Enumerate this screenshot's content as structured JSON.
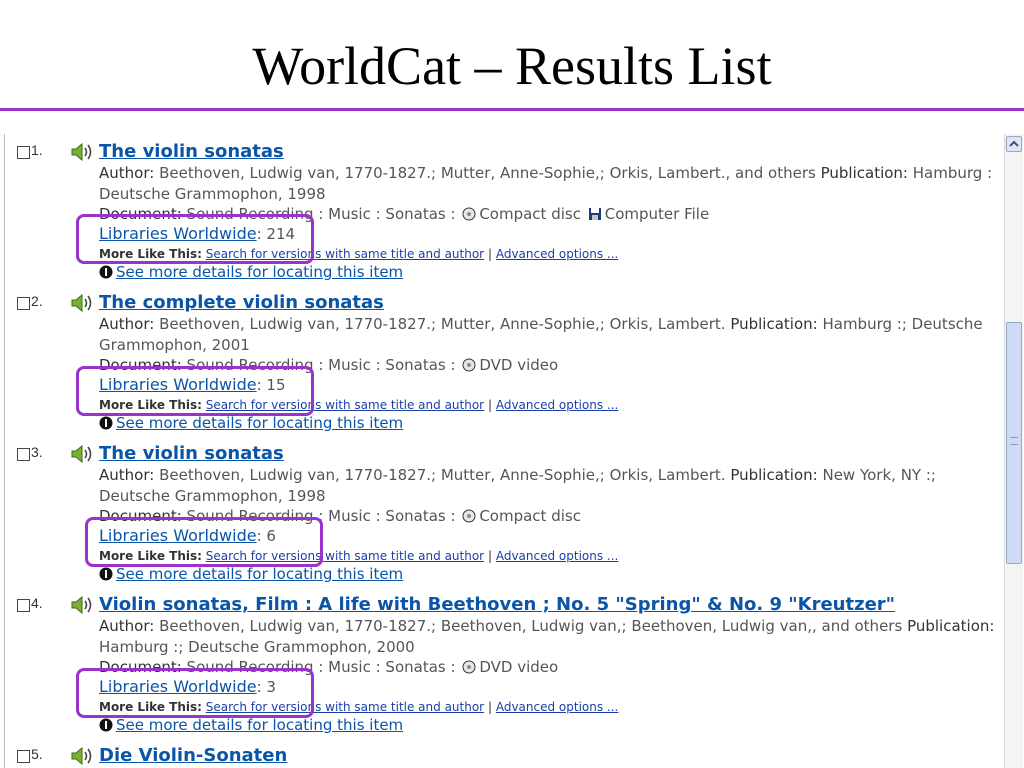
{
  "slide": {
    "title": "WorldCat – Results List"
  },
  "labels": {
    "author": "Author:",
    "publication": "Publication:",
    "document": "Document:",
    "libraries_worldwide": "Libraries Worldwide",
    "more_like_this": "More Like This:",
    "search_versions": "Search for versions with same title and author",
    "pipe": "|",
    "advanced_options": "Advanced options ...",
    "see_more_details": "See more details for locating this item"
  },
  "results": [
    {
      "number": "1.",
      "title": "The violin sonatas",
      "author_line1": "Beethoven, Ludwig van, 1770-1827.; Mutter, Anne-Sophie,; Orkis, Lambert., and others",
      "publication_line1": "Hamburg :",
      "publication_line2": "Deutsche Grammophon, 1998",
      "document_text": "Sound Recording : Music : Sonatas :",
      "formats": [
        {
          "icon": "compact-disc-icon",
          "label": "Compact disc"
        },
        {
          "icon": "floppy-disk-icon",
          "label": "Computer File"
        }
      ],
      "libraries_count": ": 214"
    },
    {
      "number": "2.",
      "title": "The complete violin sonatas",
      "author_line1": "Beethoven, Ludwig van, 1770-1827.; Mutter, Anne-Sophie,; Orkis, Lambert.",
      "publication_line1": "Hamburg :; Deutsche",
      "publication_line2": "Grammophon, 2001",
      "document_text": "Sound Recording : Music : Sonatas :",
      "formats": [
        {
          "icon": "dvd-icon",
          "label": "DVD video"
        }
      ],
      "libraries_count": ": 15"
    },
    {
      "number": "3.",
      "title": "The violin sonatas",
      "author_line1": "Beethoven, Ludwig van, 1770-1827.; Mutter, Anne-Sophie,; Orkis, Lambert.",
      "publication_line1": "New York, NY :;",
      "publication_line2": "Deutsche Grammophon, 1998",
      "document_text": "Sound Recording : Music : Sonatas :",
      "formats": [
        {
          "icon": "compact-disc-icon",
          "label": "Compact disc"
        }
      ],
      "libraries_count": ": 6"
    },
    {
      "number": "4.",
      "title": "Violin sonatas, Film : A life with Beethoven ; No. 5 \"Spring\" & No. 9 \"Kreutzer\"",
      "author_line1": "Beethoven, Ludwig van, 1770-1827.; Beethoven, Ludwig van,; Beethoven, Ludwig van,, and others",
      "publication_line1": "",
      "publication_line2": "Hamburg :; Deutsche Grammophon, 2000",
      "document_text": "Sound Recording : Music : Sonatas :",
      "formats": [
        {
          "icon": "dvd-icon",
          "label": "DVD video"
        }
      ],
      "libraries_count": ": 3"
    },
    {
      "number": "5.",
      "title": "Die Violin-Sonaten"
    }
  ]
}
